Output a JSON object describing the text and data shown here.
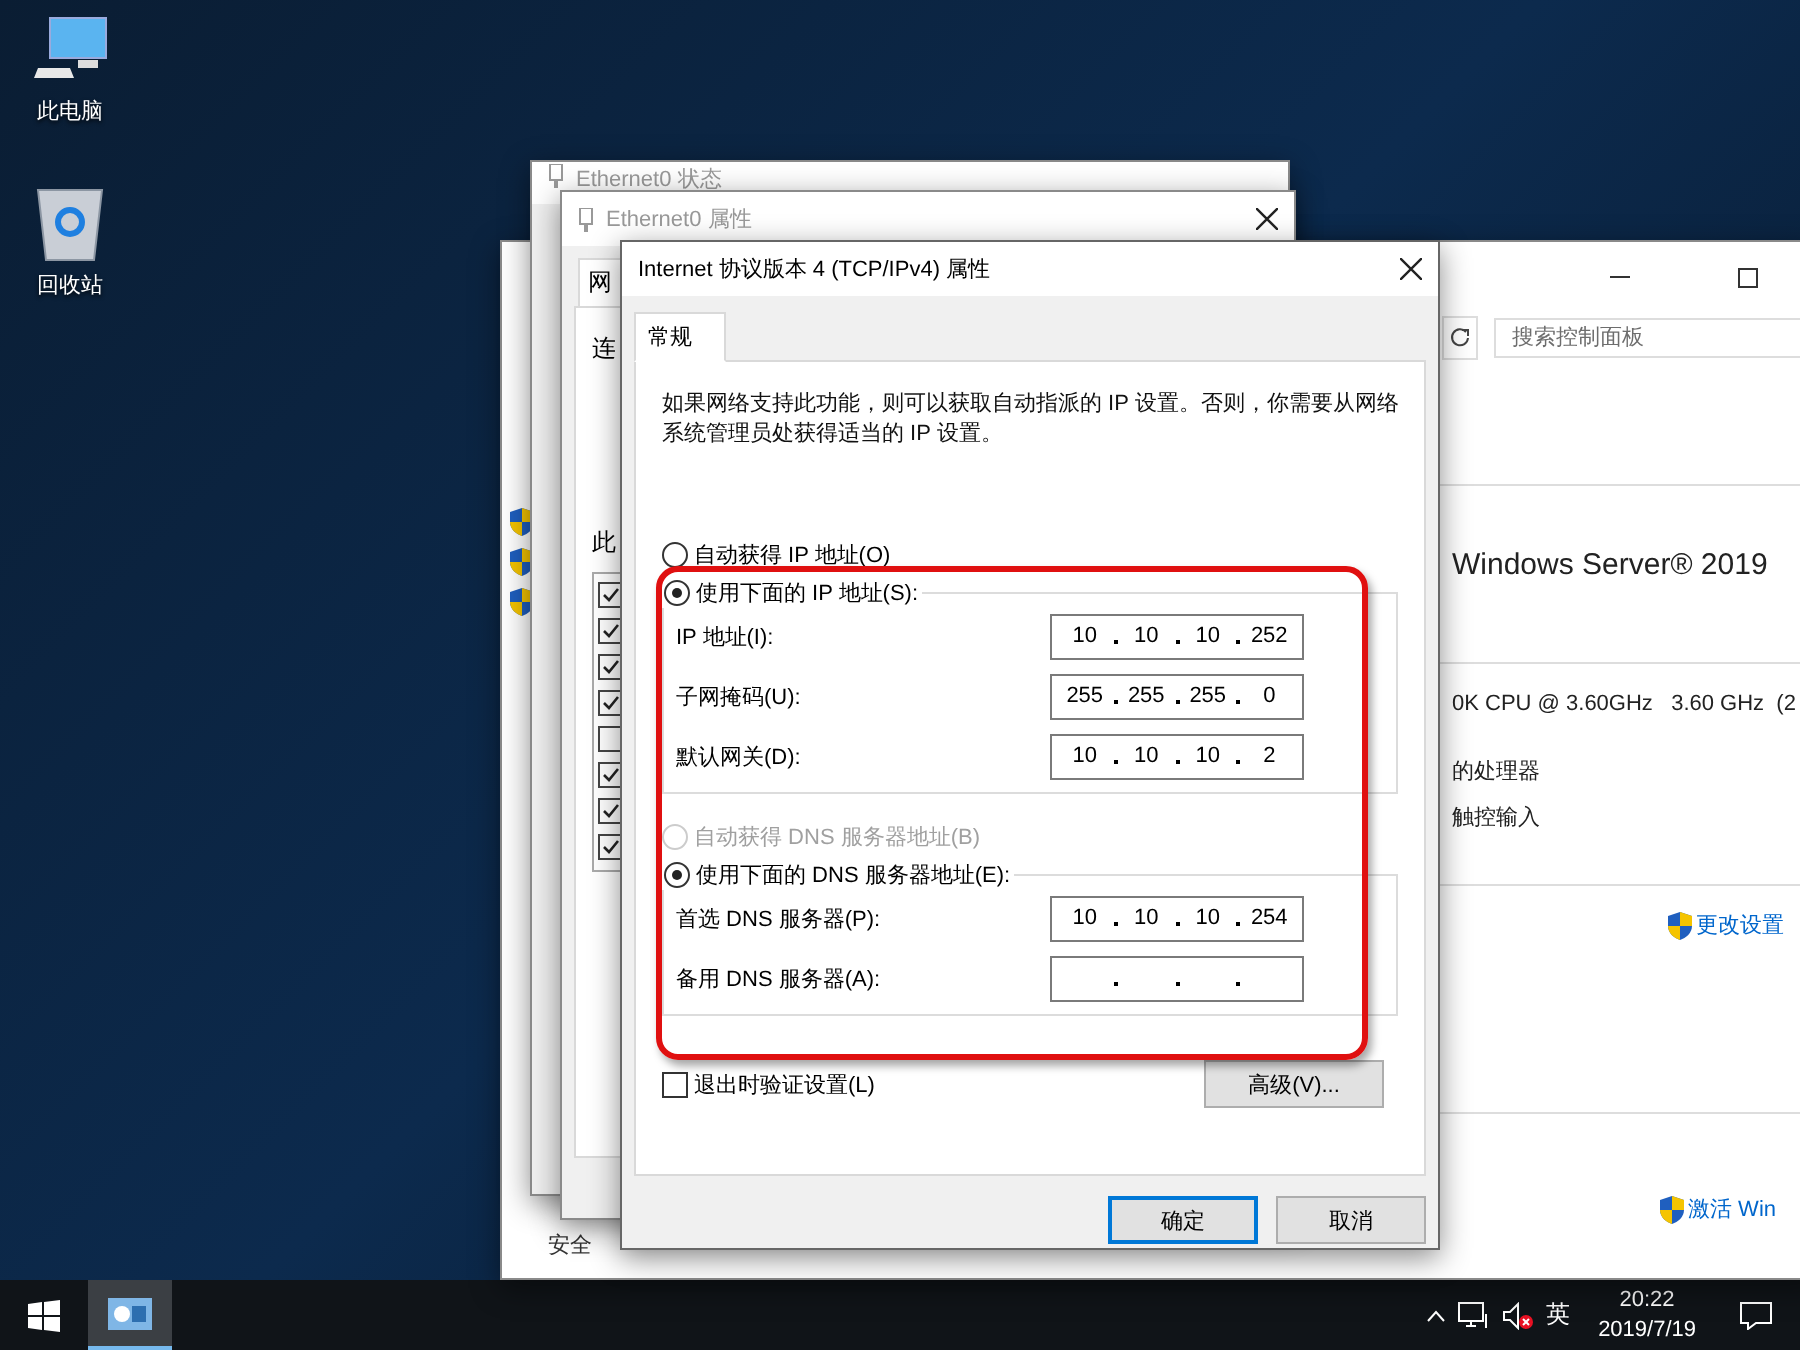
{
  "desktop": {
    "icons": [
      {
        "kind": "computer",
        "label": "此电脑"
      },
      {
        "kind": "recycle-bin",
        "label": "回收站"
      }
    ]
  },
  "system_window": {
    "search": {
      "placeholder": "搜索控制面板"
    },
    "edition": "Windows Server® 2019",
    "processor": "0K CPU @ 3.60GHz   3.60 GHz  (2",
    "notes": [
      "的处理器",
      "触控输入"
    ],
    "change_settings": "更改设置",
    "activation": "激活 Win",
    "footer": "安全"
  },
  "status_window": {
    "title": "Ethernet0 状态"
  },
  "properties_window": {
    "title": "Ethernet0 属性",
    "tab": "网",
    "labels": [
      "连",
      "此"
    ],
    "components": [
      {
        "checked": true
      },
      {
        "checked": true
      },
      {
        "checked": true
      },
      {
        "checked": true
      },
      {
        "checked": false
      },
      {
        "checked": true
      },
      {
        "checked": true
      },
      {
        "checked": true
      }
    ]
  },
  "ipv4_dialog": {
    "title": "Internet 协议版本 4 (TCP/IPv4) 属性",
    "tabs": [
      {
        "label": "常规",
        "selected": true
      }
    ],
    "description": "如果网络支持此功能，则可以获取自动指派的 IP 设置。否则，你需要从网络系统管理员处获得适当的 IP 设置。",
    "ip_mode": [
      {
        "label": "自动获得 IP 地址(O)",
        "selected": false
      },
      {
        "label": "使用下面的 IP 地址(S):",
        "selected": true
      }
    ],
    "ip_fields": [
      {
        "label": "IP 地址(I):",
        "octets": [
          "10",
          "10",
          "10",
          "252"
        ]
      },
      {
        "label": "子网掩码(U):",
        "octets": [
          "255",
          "255",
          "255",
          "0"
        ]
      },
      {
        "label": "默认网关(D):",
        "octets": [
          "10",
          "10",
          "10",
          "2"
        ]
      }
    ],
    "dns_mode": [
      {
        "label": "自动获得 DNS 服务器地址(B)",
        "selected": false,
        "disabled": true
      },
      {
        "label": "使用下面的 DNS 服务器地址(E):",
        "selected": true,
        "disabled": false
      }
    ],
    "dns_fields": [
      {
        "label": "首选 DNS 服务器(P):",
        "octets": [
          "10",
          "10",
          "10",
          "254"
        ]
      },
      {
        "label": "备用 DNS 服务器(A):"
      }
    ],
    "validate": {
      "label": "退出时验证设置(L)",
      "checked": false
    },
    "advanced_button": "高级(V)...",
    "buttons": [
      {
        "label": "确定",
        "default": true
      },
      {
        "label": "取消",
        "default": false
      }
    ]
  },
  "taskbar": {
    "ime": "英",
    "time": "20:22",
    "date": "2019/7/19"
  }
}
